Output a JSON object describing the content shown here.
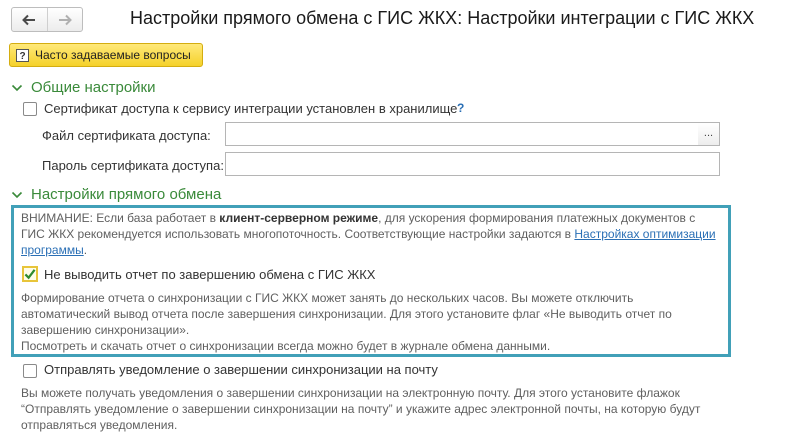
{
  "header": {
    "title": "Настройки прямого обмена с ГИС ЖКХ: Настройки интеграции с ГИС ЖКХ",
    "back_icon": "arrow-left-icon",
    "forward_icon": "arrow-right-icon"
  },
  "faq_button": {
    "label": "Часто задаваемые вопросы",
    "icon": "question-icon"
  },
  "general": {
    "section_title": "Общие настройки",
    "cert_in_storage": {
      "label": "Сертификат доступа к сервису интеграции установлен в хранилище",
      "checked": false,
      "help": "?"
    },
    "cert_file": {
      "label": "Файл сертификата доступа:",
      "value": "",
      "browse": "..."
    },
    "cert_password": {
      "label": "Пароль сертификата доступа:",
      "value": ""
    }
  },
  "direct": {
    "section_title": "Настройки прямого обмена",
    "warning": {
      "prefix": "ВНИМАНИЕ: Если база работает в ",
      "bold": "клиент-серверном режиме",
      "mid": ", для ускорения формирования платежных документов с ГИС ЖКХ рекомендуется использовать многопоточность. Соответствующие настройки задаются в ",
      "link": "Настройках оптимизации программы",
      "suffix": "."
    },
    "no_report": {
      "label": "Не выводить отчет по завершению обмена с ГИС ЖКХ",
      "checked": true,
      "hint": "Формирование отчета о синхронизации с ГИС ЖКХ может занять до нескольких часов. Вы можете отключить автоматический вывод отчета после завершения синхронизации. Для этого установите флаг «Не выводить отчет по завершению синхронизации».",
      "hint2": "Посмотреть и скачать отчет о синхронизации всегда можно будет в журнале обмена данными."
    },
    "email_notify": {
      "label": "Отправлять уведомление о завершении синхронизации на почту",
      "checked": false,
      "hint": "Вы можете получать уведомления о завершении синхронизации на электронную почту. Для этого установите флажок “Отправлять уведомление о завершении синхронизации на почту” и укажите адрес электронной почты, на которую будут отправляться уведомления."
    }
  },
  "colors": {
    "section": "#3a8a3a",
    "accent_frame": "#41a0b8",
    "faq_bg": "#f5d12a",
    "link": "#2a6fb5"
  }
}
